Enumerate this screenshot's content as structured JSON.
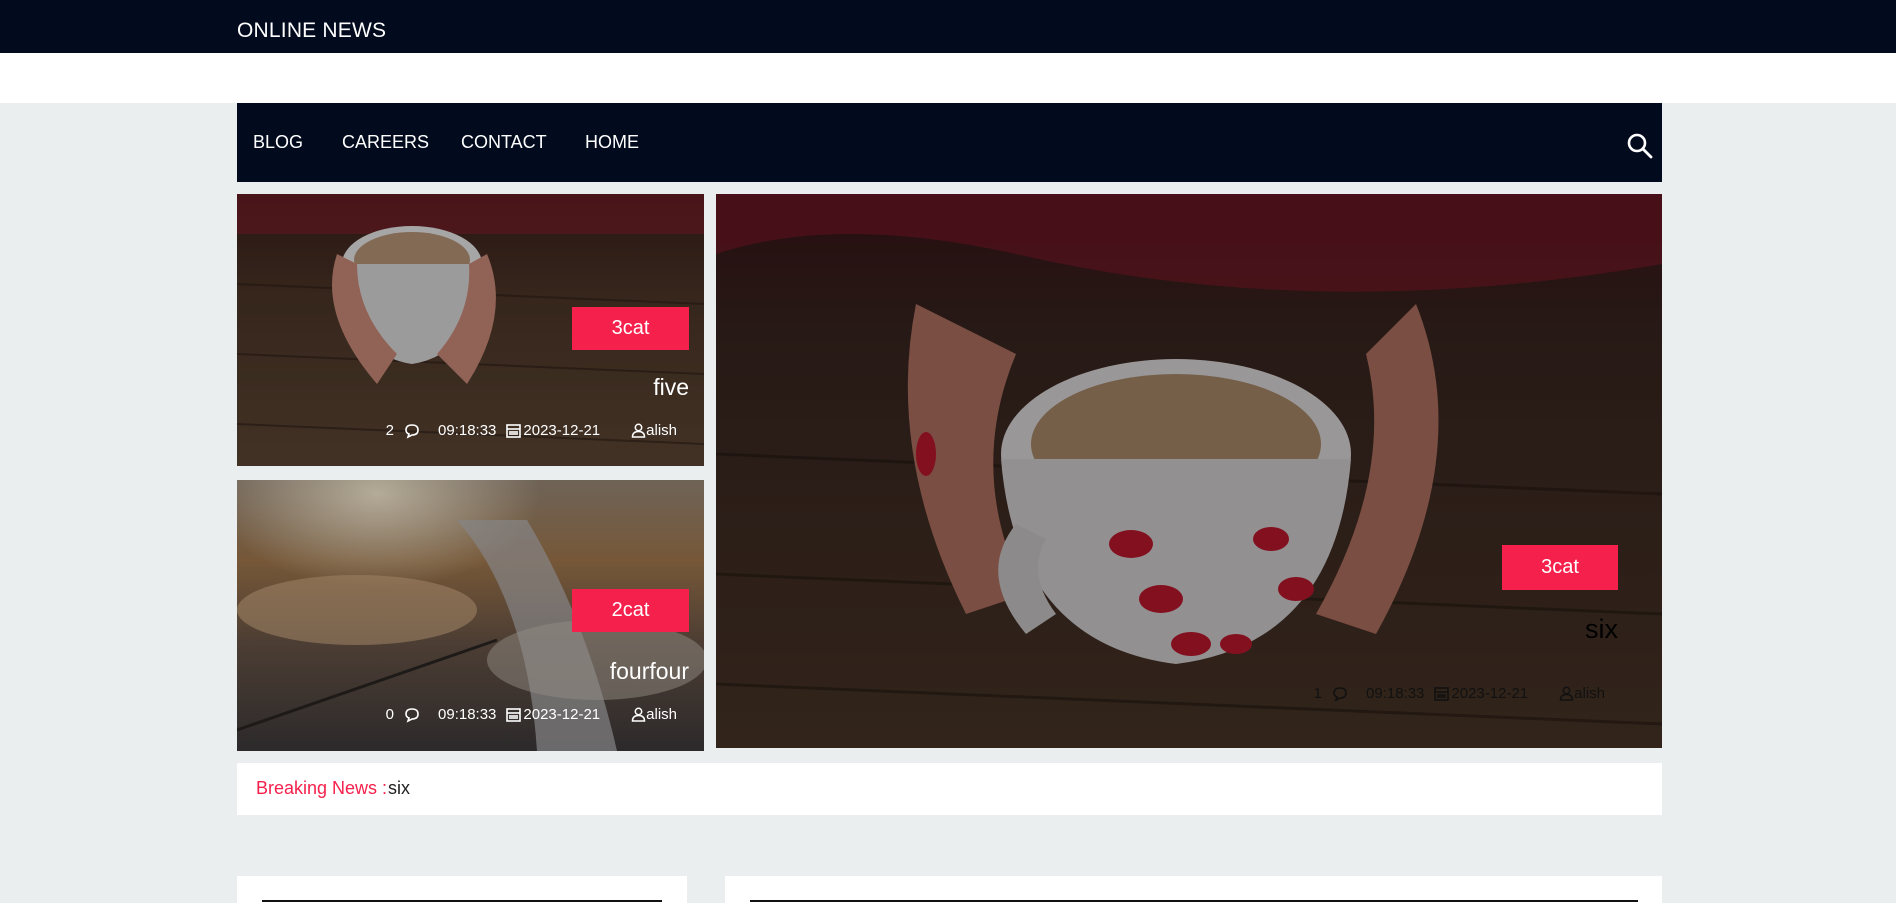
{
  "site": {
    "title": "ONLINE NEWS"
  },
  "nav": {
    "items": [
      {
        "label": "BLOG"
      },
      {
        "label": "CAREERS"
      },
      {
        "label": "CONTACT"
      },
      {
        "label": "HOME"
      }
    ],
    "search_icon": "search-icon"
  },
  "posts": {
    "top_left": {
      "category": "3cat",
      "title": "five",
      "comments": "2",
      "time": "09:18:33",
      "date": "2023-12-21",
      "author": "alish"
    },
    "bottom_left": {
      "category": "2cat",
      "title": "fourfour",
      "comments": "0",
      "time": "09:18:33",
      "date": "2023-12-21",
      "author": "alish"
    },
    "featured": {
      "category": "3cat",
      "title": "six",
      "comments": "1",
      "time": "09:18:33",
      "date": "2023-12-21",
      "author": "alish"
    }
  },
  "breaking": {
    "label": "Breaking News :",
    "text": "six"
  },
  "colors": {
    "navy": "#020a1e",
    "accent": "#f5204c",
    "page_bg": "#ebeeef"
  }
}
